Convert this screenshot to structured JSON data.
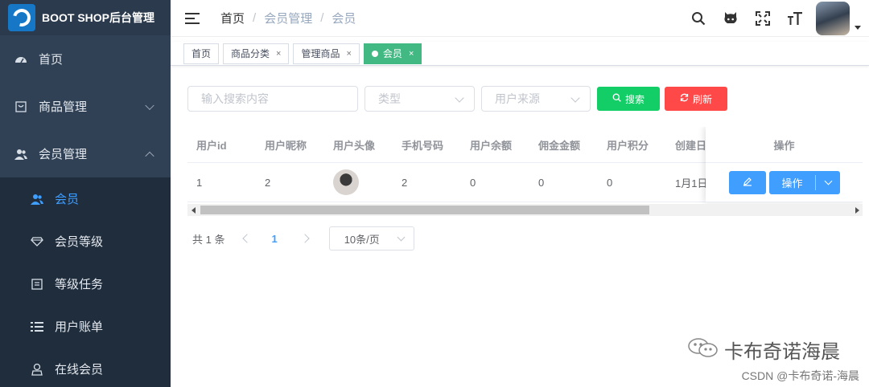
{
  "app": {
    "title": "BOOT SHOP后台管理"
  },
  "sidebar": {
    "items": [
      {
        "label": "首页",
        "icon": "dashboard-icon"
      },
      {
        "label": "商品管理",
        "icon": "goods-icon"
      },
      {
        "label": "会员管理",
        "icon": "users-icon"
      }
    ],
    "subitems": [
      {
        "label": "会员",
        "icon": "user-icon",
        "active": true
      },
      {
        "label": "会员等级",
        "icon": "diamond-icon"
      },
      {
        "label": "等级任务",
        "icon": "task-icon"
      },
      {
        "label": "用户账单",
        "icon": "list-icon"
      },
      {
        "label": "在线会员",
        "icon": "online-user-icon"
      }
    ]
  },
  "header": {
    "breadcrumb": [
      "首页",
      "会员管理",
      "会员"
    ],
    "separator": "/",
    "icons": [
      "search-icon",
      "github-icon",
      "fullscreen-icon",
      "font-size-icon"
    ]
  },
  "tags": [
    {
      "label": "首页",
      "closable": false
    },
    {
      "label": "商品分类",
      "closable": true
    },
    {
      "label": "管理商品",
      "closable": true
    },
    {
      "label": "会员",
      "closable": true,
      "active": true
    }
  ],
  "tag_close": "×",
  "filters": {
    "search_placeholder": "输入搜索内容",
    "type_placeholder": "类型",
    "source_placeholder": "用户来源",
    "search_button": "搜索",
    "refresh_button": "刷新"
  },
  "table": {
    "columns": [
      "用户id",
      "用户昵称",
      "用户头像",
      "手机号码",
      "用户余额",
      "佣金金额",
      "用户积分",
      "创建日期"
    ],
    "rows": [
      {
        "id": "1",
        "nickname": "2",
        "phone": "2",
        "balance": "0",
        "commission": "0",
        "points": "0",
        "created": "1月1日"
      }
    ],
    "action_header": "操作",
    "action_button": "操作"
  },
  "pagination": {
    "total_text": "共 1 条",
    "current_page": "1",
    "page_size": "10条/页"
  },
  "watermark": {
    "line1": "卡布奇诺海晨",
    "line2": "CSDN @卡布奇诺-海晨"
  },
  "colors": {
    "sidebar_bg": "#304156",
    "active": "#409eff",
    "tag_active": "#42b983",
    "search_btn": "#13ce66",
    "refresh_btn": "#ff4949"
  }
}
